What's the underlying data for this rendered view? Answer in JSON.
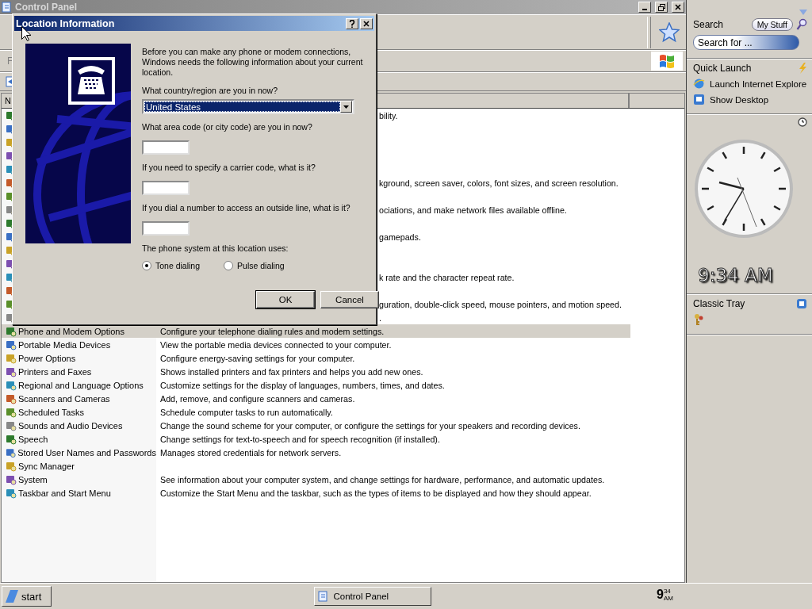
{
  "window": {
    "title": "Control Panel",
    "menu_fragment": "F",
    "column_header_fragment": "N"
  },
  "rows": [
    {
      "kind": "covered",
      "selected": false,
      "description": "bility."
    },
    {
      "kind": "covered",
      "selected": false
    },
    {
      "kind": "covered",
      "selected": false
    },
    {
      "kind": "covered",
      "selected": false
    },
    {
      "kind": "covered",
      "selected": false
    },
    {
      "kind": "covered",
      "selected": false,
      "description": "kground, screen saver, colors, font sizes, and screen resolution."
    },
    {
      "kind": "covered",
      "selected": false
    },
    {
      "kind": "covered",
      "selected": false,
      "description": "ociations, and make network files available offline."
    },
    {
      "kind": "covered",
      "selected": false
    },
    {
      "kind": "covered",
      "selected": false,
      "description": "gamepads."
    },
    {
      "kind": "covered",
      "selected": false
    },
    {
      "kind": "covered",
      "selected": false
    },
    {
      "kind": "covered",
      "selected": false,
      "description": "k rate and the character repeat rate."
    },
    {
      "kind": "covered",
      "selected": false
    },
    {
      "kind": "covered",
      "selected": false,
      "description": "guration, double-click speed, mouse pointers, and motion speed."
    },
    {
      "kind": "covered",
      "selected": false,
      "description": "."
    },
    {
      "kind": "full",
      "selected": true,
      "name": "Phone and Modem Options",
      "description": "Configure your telephone dialing rules and modem settings."
    },
    {
      "kind": "full",
      "selected": false,
      "name": "Portable Media Devices",
      "description": "View the portable media devices connected to your computer."
    },
    {
      "kind": "full",
      "selected": false,
      "name": "Power Options",
      "description": "Configure energy-saving settings for your computer."
    },
    {
      "kind": "full",
      "selected": false,
      "name": "Printers and Faxes",
      "description": "Shows installed printers and fax printers and helps you add new ones."
    },
    {
      "kind": "full",
      "selected": false,
      "name": "Regional and Language Options",
      "description": "Customize settings for the display of languages, numbers, times, and dates."
    },
    {
      "kind": "full",
      "selected": false,
      "name": "Scanners and Cameras",
      "description": "Add, remove, and configure scanners and cameras."
    },
    {
      "kind": "full",
      "selected": false,
      "name": "Scheduled Tasks",
      "description": "Schedule computer tasks to run automatically."
    },
    {
      "kind": "full",
      "selected": false,
      "name": "Sounds and Audio Devices",
      "description": "Change the sound scheme for your computer, or configure the settings for your speakers and recording devices."
    },
    {
      "kind": "full",
      "selected": false,
      "name": "Speech",
      "description": "Change settings for text-to-speech and for speech recognition (if installed)."
    },
    {
      "kind": "full",
      "selected": false,
      "name": "Stored User Names and Passwords",
      "description": "Manages stored credentials for network servers."
    },
    {
      "kind": "full",
      "selected": false,
      "name": "Sync Manager"
    },
    {
      "kind": "full",
      "selected": false,
      "name": "System",
      "description": "See information about your computer system, and change settings for hardware, performance, and automatic updates."
    },
    {
      "kind": "full",
      "selected": false,
      "name": "Taskbar and Start Menu",
      "description": "Customize the Start Menu and the taskbar, such as the types of items to be displayed and how they should appear."
    }
  ],
  "dialog": {
    "title": "Location Information",
    "intro": "Before you can make any phone or modem connections, Windows needs the following information about your current location.",
    "fields": [
      {
        "kind": "select",
        "label": "What country/region are you in now?",
        "value": "United States"
      },
      {
        "kind": "text",
        "label": "What area code (or city code) are you in now?"
      },
      {
        "kind": "text",
        "label": "If you need to specify a carrier code, what is it?"
      },
      {
        "kind": "text",
        "label": "If you dial a number to access an outside line, what is it?"
      }
    ],
    "phone_system_label": "The phone system at this location uses:",
    "dialing": [
      {
        "label": "Tone dialing",
        "selected": true
      },
      {
        "label": "Pulse dialing",
        "selected": false
      }
    ],
    "buttons": [
      "OK",
      "Cancel"
    ]
  },
  "sidebar": {
    "search_label": "Search",
    "scope_button": "My Stuff",
    "search_placeholder": "Search for ...",
    "quick_launch_title": "Quick Launch",
    "quick_launch": [
      "Launch Internet Explore",
      "Show Desktop"
    ],
    "clock_time": "9:34 AM",
    "tray_title": "Classic Tray"
  },
  "taskbar": {
    "start": "start",
    "tasks": [
      "Control Panel"
    ],
    "clock": {
      "hour": "9",
      "minutes": "34",
      "period": "AM"
    }
  }
}
